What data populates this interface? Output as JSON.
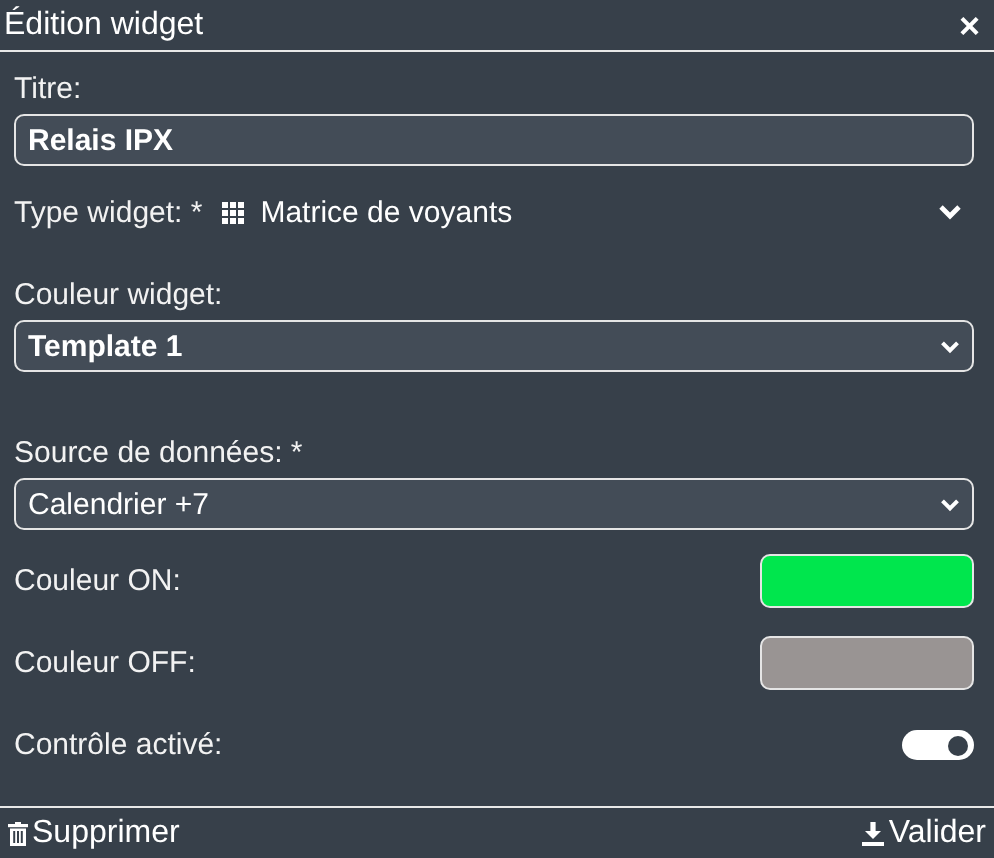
{
  "window": {
    "title": "Édition widget",
    "close": "×"
  },
  "fields": [
    {
      "kind": "text",
      "label": "Titre:",
      "value": "Relais IPX",
      "bold": true
    },
    {
      "kind": "icon-select",
      "label": "Type widget: *",
      "value": "Matrice de voyants"
    },
    {
      "kind": "select",
      "label": "Couleur widget:",
      "value": "Template 1",
      "bold": true
    },
    {
      "kind": "select",
      "label": "Source de données: *",
      "value": "Calendrier +7",
      "bold": false
    },
    {
      "kind": "color",
      "label": "Couleur ON:",
      "color": "#00e64d"
    },
    {
      "kind": "color",
      "label": "Couleur OFF:",
      "color": "#999493"
    },
    {
      "kind": "toggle",
      "label": "Contrôle activé:",
      "on": true
    }
  ],
  "footer": {
    "delete": "Supprimer",
    "submit": "Valider"
  }
}
